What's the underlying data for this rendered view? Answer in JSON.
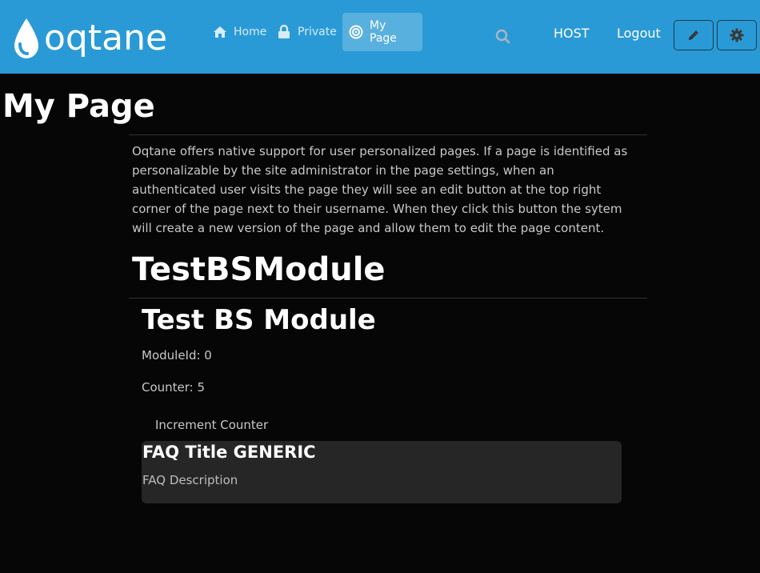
{
  "brand": {
    "name": "oqtane",
    "logo_icon": "droplet-logo-icon"
  },
  "nav": {
    "items": [
      {
        "label": "Home",
        "icon": "home-icon"
      },
      {
        "label": "Private",
        "icon": "lock-icon"
      },
      {
        "label": "My Page",
        "icon": "target-icon",
        "active": true
      }
    ]
  },
  "header": {
    "search_icon": "search-icon",
    "host_label": "HOST",
    "logout_label": "Logout",
    "edit_icon": "pencil-icon",
    "settings_icon": "gear-icon"
  },
  "page": {
    "title": "My Page",
    "intro": "Oqtane offers native support for user personalized pages. If a page is identified as personalizable by the site administrator in the page settings, when an authenticated user visits the page they will see an edit button at the top right corner of the page next to their username. When they click this button the sytem will create a new version of the page and allow them to edit the page content."
  },
  "module": {
    "container_title": "TestBSModule",
    "title": "Test BS Module",
    "module_id": "ModuleId: 0",
    "counter": "Counter: 5",
    "increment_label": "Increment Counter",
    "faq": {
      "title": "FAQ Title GENERIC",
      "description": "FAQ Description"
    }
  },
  "colors": {
    "brand": "#2a9ad7",
    "background": "#060606",
    "card": "#262626",
    "text": "#c8c8c8"
  }
}
